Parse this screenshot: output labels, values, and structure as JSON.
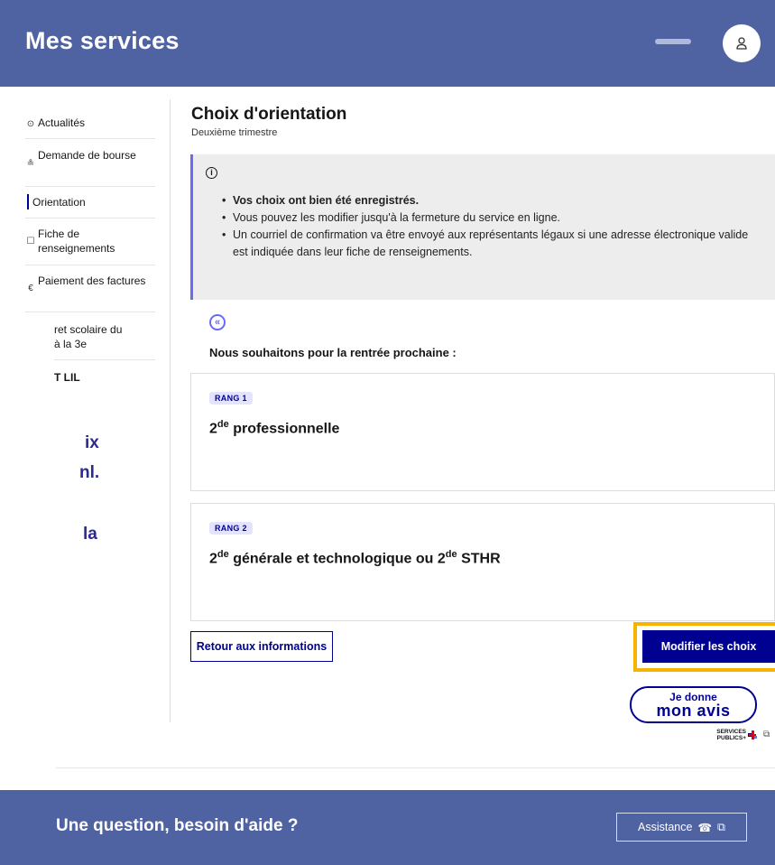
{
  "header": {
    "title": "Mes services"
  },
  "sidebar": {
    "items": [
      {
        "label": "Actualités"
      },
      {
        "label": "Demande de bourse"
      },
      {
        "label": "Orientation"
      },
      {
        "label": "Fiche de renseignements"
      },
      {
        "label": "Paiement des factures"
      },
      {
        "label_line1": "ret scolaire du",
        "label_line2": "à la 3e"
      },
      {
        "label": "T LIL"
      }
    ]
  },
  "overlay_text": {
    "line1": "ix",
    "line2": "nl.",
    "line3": "la"
  },
  "main": {
    "title": "Choix d'orientation",
    "subtitle": "Deuxième trimestre",
    "info": {
      "items": [
        "Vos choix ont bien été enregistrés.",
        "Vous pouvez les modifier jusqu'à la fermeture du service en ligne.",
        "Un courriel de confirmation va être envoyé aux représentants légaux si une adresse électronique valide est indiquée dans leur fiche de renseignements."
      ]
    },
    "intro": "Nous souhaitons pour la rentrée prochaine :",
    "choices": [
      {
        "rank": "RANG 1",
        "pre": "2",
        "sup": "de",
        "text": " professionnelle"
      },
      {
        "rank": "RANG 2",
        "pre": "2",
        "sup": "de",
        "text": " générale et technologique ou 2",
        "sup2": "de",
        "text2": " STHR"
      }
    ],
    "return_button": "Retour aux informations",
    "modify_button": "Modifier les choix"
  },
  "feedback": {
    "line1": "Je donne",
    "line2": "mon avis",
    "brand_line1": "SERVICES",
    "brand_line2": "PUBLICS+"
  },
  "footer": {
    "title": "Une question, besoin d'aide ?",
    "assist_button": "Assistance"
  },
  "colors": {
    "header_bg": "#4f63a3",
    "primary": "#000091",
    "highlight": "#f6b300",
    "info_bg": "#ededed"
  }
}
